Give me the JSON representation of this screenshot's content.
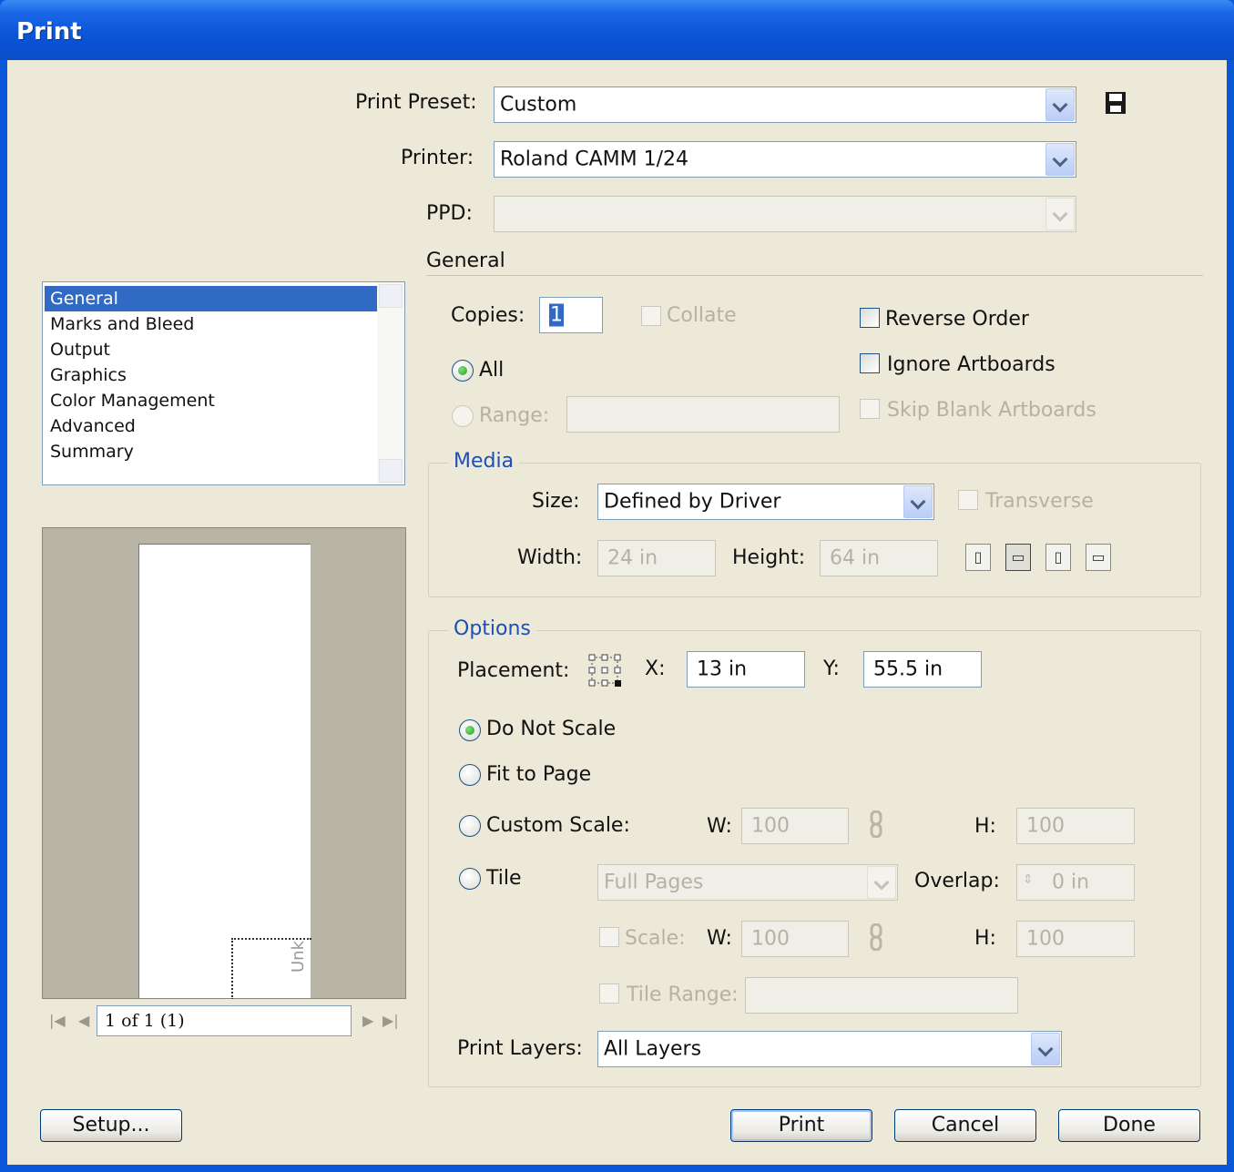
{
  "window": {
    "title": "Print"
  },
  "header": {
    "print_preset_label": "Print Preset:",
    "print_preset_value": "Custom",
    "printer_label": "Printer:",
    "printer_value": "Roland CAMM 1/24",
    "ppd_label": "PPD:",
    "ppd_value": ""
  },
  "sidebar": {
    "items": [
      {
        "label": "General",
        "selected": true
      },
      {
        "label": "Marks and Bleed",
        "selected": false
      },
      {
        "label": "Output",
        "selected": false
      },
      {
        "label": "Graphics",
        "selected": false
      },
      {
        "label": "Color Management",
        "selected": false
      },
      {
        "label": "Advanced",
        "selected": false
      },
      {
        "label": "Summary",
        "selected": false
      }
    ]
  },
  "preview": {
    "page_indicator": "1 of 1 (1)",
    "artboard_label": "Unk"
  },
  "general": {
    "section_title": "General",
    "copies_label": "Copies:",
    "copies_value": "1",
    "collate_label": "Collate",
    "reverse_order_label": "Reverse Order",
    "ignore_artboards_label": "Ignore Artboards",
    "skip_blank_label": "Skip Blank Artboards",
    "all_label": "All",
    "range_label": "Range:",
    "range_value": ""
  },
  "media": {
    "title": "Media",
    "size_label": "Size:",
    "size_value": "Defined by Driver",
    "transverse_label": "Transverse",
    "width_label": "Width:",
    "width_value": "24 in",
    "height_label": "Height:",
    "height_value": "64 in"
  },
  "options": {
    "title": "Options",
    "placement_label": "Placement:",
    "x_label": "X:",
    "x_value": "13 in",
    "y_label": "Y:",
    "y_value": "55.5 in",
    "do_not_scale_label": "Do Not Scale",
    "fit_to_page_label": "Fit to Page",
    "custom_scale_label": "Custom Scale:",
    "w_label": "W:",
    "w_value": "100",
    "h_label": "H:",
    "h_value": "100",
    "tile_label": "Tile",
    "tile_value": "Full Pages",
    "overlap_label": "Overlap:",
    "overlap_value": "0 in",
    "scale_label": "Scale:",
    "scale_w_label": "W:",
    "scale_w_value": "100",
    "scale_h_label": "H:",
    "scale_h_value": "100",
    "tile_range_label": "Tile Range:",
    "tile_range_value": "",
    "print_layers_label": "Print Layers:",
    "print_layers_value": "All Layers"
  },
  "buttons": {
    "setup": "Setup...",
    "print": "Print",
    "cancel": "Cancel",
    "done": "Done"
  }
}
